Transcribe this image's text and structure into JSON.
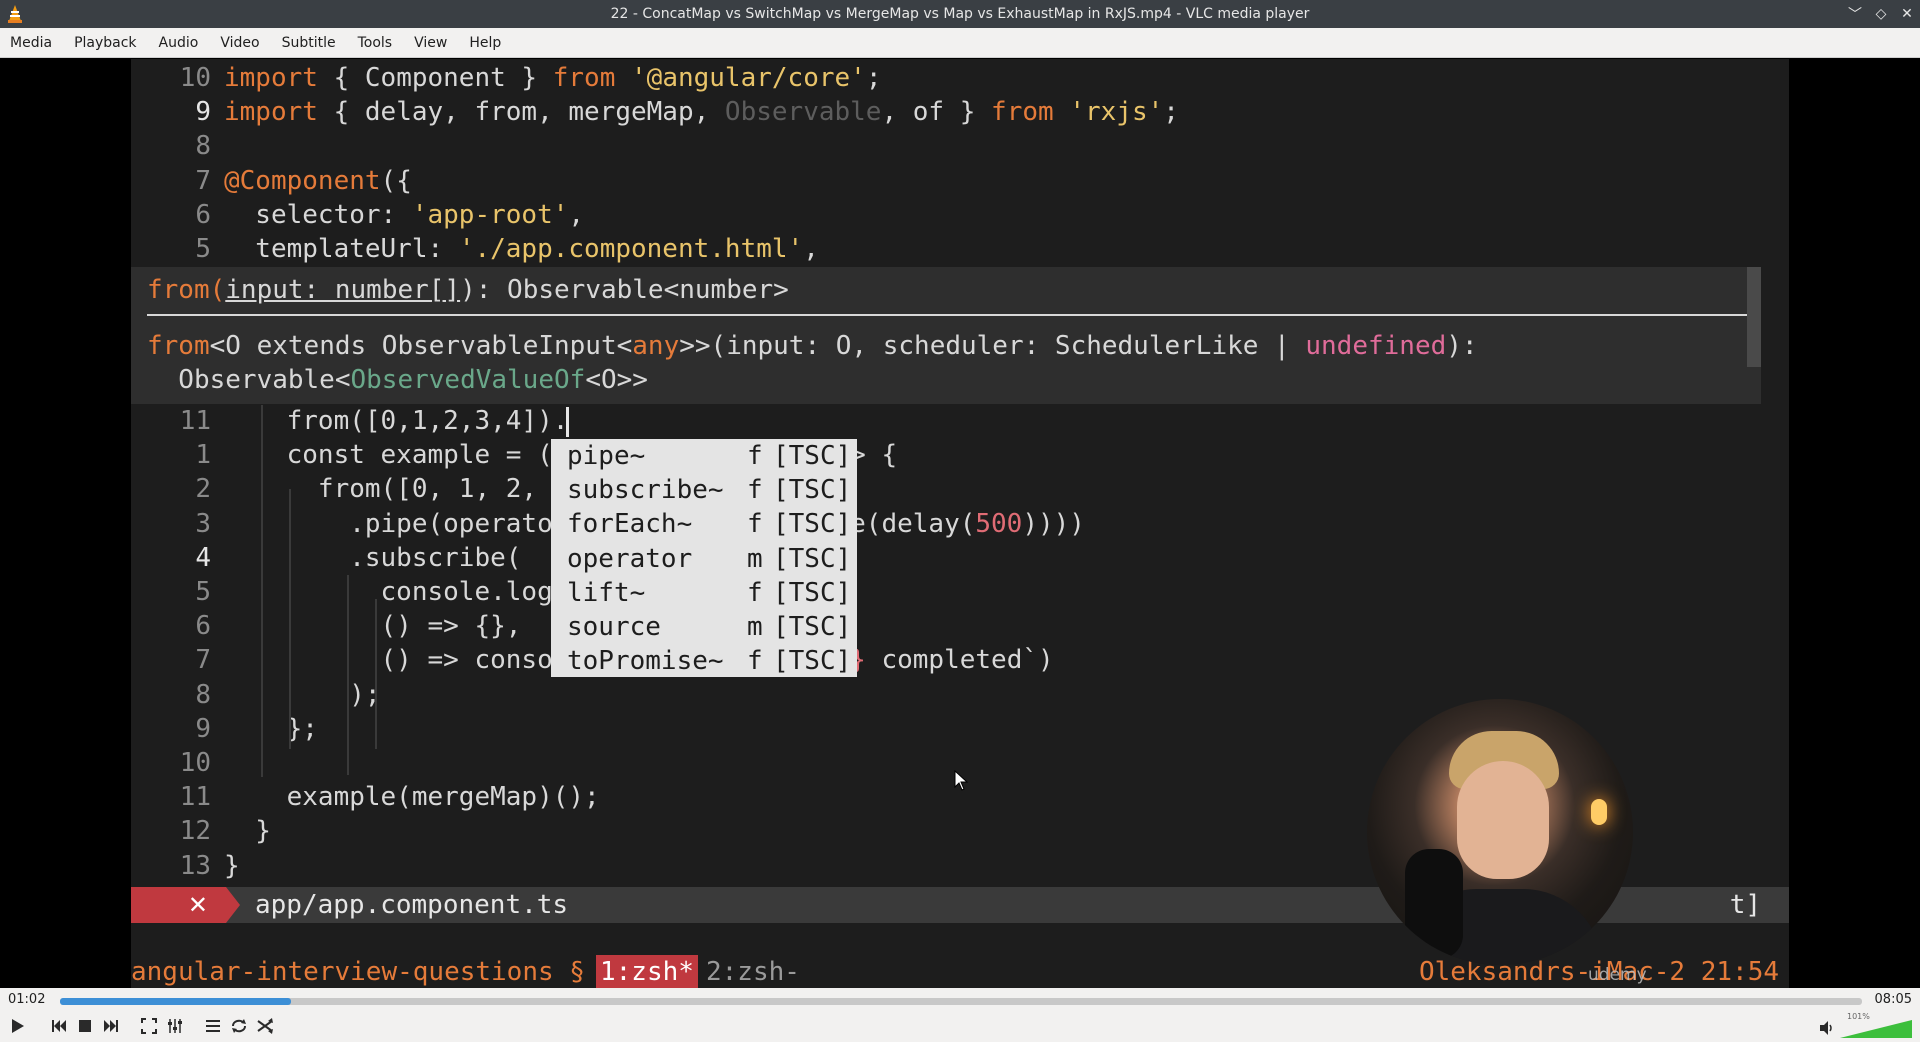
{
  "window": {
    "title": "22 - ConcatMap vs SwitchMap vs MergeMap vs Map vs ExhaustMap in RxJS.mp4 - VLC media player",
    "controls": [
      "﹀",
      "◇",
      "✕"
    ]
  },
  "menu": [
    "Media",
    "Playback",
    "Audio",
    "Video",
    "Subtitle",
    "Tools",
    "View",
    "Help"
  ],
  "editor": {
    "lines_top": [
      {
        "n": "10",
        "parts": [
          [
            "kw",
            "import"
          ],
          [
            "cls",
            " { Component } "
          ],
          [
            "kw",
            "from"
          ],
          [
            "str",
            " '@angular/core'"
          ],
          [
            "cls",
            ";"
          ]
        ]
      },
      {
        "n": "9",
        "cur": true,
        "dot": true,
        "parts": [
          [
            "kw",
            "import"
          ],
          [
            "cls",
            " { delay, from, mergeMap, "
          ],
          [
            "dim",
            "Observable"
          ],
          [
            "cls",
            ", of } "
          ],
          [
            "kw",
            "from"
          ],
          [
            "str",
            " 'rxjs'"
          ],
          [
            "cls",
            ";"
          ]
        ]
      },
      {
        "n": "8",
        "parts": []
      },
      {
        "n": "7",
        "parts": [
          [
            "kw",
            "@Component"
          ],
          [
            "cls",
            "({"
          ]
        ]
      },
      {
        "n": "6",
        "parts": [
          [
            "cls",
            "  selector: "
          ],
          [
            "str",
            "'app-root'"
          ],
          [
            "cls",
            ","
          ]
        ]
      },
      {
        "n": "5",
        "parts": [
          [
            "cls",
            "  templateUrl: "
          ],
          [
            "str",
            "'./app.component.html'"
          ],
          [
            "cls",
            ","
          ]
        ]
      }
    ],
    "signature": {
      "line1_a": "from(",
      "line1_b": "input: number[]",
      "line1_c": "): Observable<number>",
      "line2_a": "from",
      "line2_b": "<O extends ObservableInput<",
      "line2_c": "any",
      "line2_d": ">>(input: O, scheduler: SchedulerLike | ",
      "line2_e": "undefined",
      "line2_f": "):",
      "line3_a": "  Observable<",
      "line3_b": "ObservedValueOf",
      "line3_c": "<O>>"
    },
    "lines_bottom": [
      {
        "n": "11",
        "cur": false,
        "parts": [
          [
            "cls",
            "    from([0,1,2,3,4])."
          ]
        ]
      },
      {
        "n": "1",
        "parts": [
          [
            "cls",
            "    const example = ("
          ],
          [
            "cls",
            "                  "
          ],
          [
            "cls",
            "=> {"
          ]
        ]
      },
      {
        "n": "2",
        "parts": [
          [
            "cls",
            "      from([0, 1, 2, "
          ]
        ]
      },
      {
        "n": "3",
        "parts": [
          [
            "cls",
            "        .pipe(operato"
          ],
          [
            "cls",
            "                "
          ],
          [
            "cls",
            "pipe(delay("
          ],
          [
            "num",
            "500"
          ],
          [
            "cls",
            "))))"
          ]
        ]
      },
      {
        "n": "4",
        "cur": true,
        "dot": true,
        "parts": [
          [
            "cls",
            "        .subscribe("
          ]
        ]
      },
      {
        "n": "5",
        "parts": [
          [
            "cls",
            "          console.log"
          ]
        ]
      },
      {
        "n": "6",
        "parts": [
          [
            "cls",
            "          () => {},"
          ]
        ]
      },
      {
        "n": "7",
        "parts": [
          [
            "cls",
            "          () => conso"
          ],
          [
            "cls",
            "                "
          ],
          [
            "num",
            "ame}"
          ],
          [
            "cls",
            " completed`)"
          ]
        ]
      },
      {
        "n": "8",
        "parts": [
          [
            "cls",
            "        );"
          ]
        ]
      },
      {
        "n": "9",
        "parts": [
          [
            "cls",
            "    };"
          ]
        ]
      },
      {
        "n": "10",
        "parts": []
      },
      {
        "n": "11",
        "parts": [
          [
            "cls",
            "    example(mergeMap)();"
          ]
        ]
      },
      {
        "n": "12",
        "parts": [
          [
            "cls",
            "  }"
          ]
        ]
      },
      {
        "n": "13",
        "parts": [
          [
            "cls",
            "}"
          ]
        ]
      }
    ],
    "completion": [
      {
        "name": "pipe~",
        "kind": "f",
        "src": "[TSC]"
      },
      {
        "name": "subscribe~",
        "kind": "f",
        "src": "[TSC]"
      },
      {
        "name": "forEach~",
        "kind": "f",
        "src": "[TSC]"
      },
      {
        "name": "operator",
        "kind": "m",
        "src": "[TSC]"
      },
      {
        "name": "lift~",
        "kind": "f",
        "src": "[TSC]"
      },
      {
        "name": "source",
        "kind": "m",
        "src": "[TSC]"
      },
      {
        "name": "toPromise~",
        "kind": "f",
        "src": "[TSC]"
      }
    ],
    "status": {
      "x": "✕",
      "file": "app/app.component.ts",
      "tail": "t]"
    },
    "tmux": {
      "session": "angular-interview-questions § ",
      "win1": "1:zsh*",
      "win2": "2:zsh-",
      "host": "Oleksandrs-iMac-2 21:54"
    },
    "watermark": "udemy"
  },
  "player": {
    "elapsed": "01:02",
    "total": "08:05",
    "progress": 0.128,
    "volume_label": "101%",
    "volume": 1.01
  }
}
